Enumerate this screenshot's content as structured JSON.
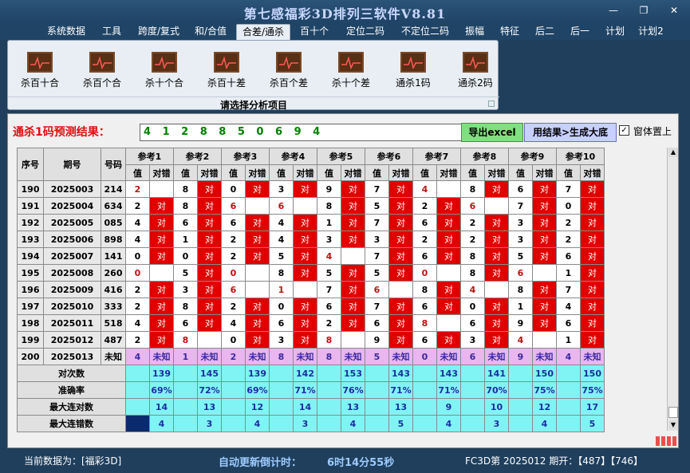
{
  "window": {
    "title": "第七感福彩3D排列三软件V8.81"
  },
  "menu": [
    "系统数据",
    "工具",
    "跨度/复式",
    "和/合值",
    "合差/通杀",
    "百十个",
    "定位二码",
    "不定位二码",
    "振幅",
    "特征",
    "后二",
    "后一",
    "计划",
    "计划2"
  ],
  "menu_active": 4,
  "ribbon": {
    "buttons": [
      "杀百十合",
      "杀百个合",
      "杀十个合",
      "杀百十差",
      "杀百个差",
      "杀十个差",
      "通杀1码",
      "通杀2码"
    ],
    "caption": "请选择分析项目"
  },
  "prediction": {
    "label": "通杀1码预测结果：",
    "value": "4 1 2 8 8 5 0 6 9 4",
    "export_label": "导出excel",
    "apply_label": "用结果>生成大底",
    "ontop_label": "窗体置上",
    "ontop_checked": "✓"
  },
  "table": {
    "col_seq": "序号",
    "col_period": "期号",
    "col_num": "号码",
    "refs": [
      "参考1",
      "参考2",
      "参考3",
      "参考4",
      "参考5",
      "参考6",
      "参考7",
      "参考8",
      "参考9",
      "参考10"
    ],
    "sub_value": "值",
    "sub_check": "对错",
    "right_mark": "对",
    "rows": [
      {
        "id": "190",
        "period": "2025003",
        "num": "214",
        "v": [
          "2",
          "8",
          "0",
          "3",
          "9",
          "7",
          "4",
          "8",
          "6",
          "7"
        ],
        "ok": [
          0,
          1,
          1,
          1,
          1,
          1,
          0,
          1,
          1,
          1
        ]
      },
      {
        "id": "191",
        "period": "2025004",
        "num": "634",
        "v": [
          "2",
          "8",
          "6",
          "6",
          "8",
          "5",
          "2",
          "6",
          "7",
          "0"
        ],
        "ok": [
          1,
          1,
          0,
          0,
          1,
          1,
          1,
          0,
          1,
          1
        ]
      },
      {
        "id": "192",
        "period": "2025005",
        "num": "085",
        "v": [
          "4",
          "6",
          "6",
          "4",
          "1",
          "7",
          "6",
          "2",
          "3",
          "2"
        ],
        "ok": [
          1,
          1,
          1,
          1,
          1,
          1,
          1,
          1,
          1,
          1
        ]
      },
      {
        "id": "193",
        "period": "2025006",
        "num": "898",
        "v": [
          "4",
          "1",
          "2",
          "4",
          "3",
          "3",
          "2",
          "2",
          "3",
          "2"
        ],
        "ok": [
          1,
          1,
          1,
          1,
          1,
          1,
          1,
          1,
          1,
          1
        ]
      },
      {
        "id": "194",
        "period": "2025007",
        "num": "141",
        "v": [
          "0",
          "0",
          "2",
          "5",
          "4",
          "7",
          "6",
          "8",
          "5",
          "6"
        ],
        "ok": [
          1,
          1,
          1,
          1,
          0,
          1,
          1,
          1,
          1,
          1
        ]
      },
      {
        "id": "195",
        "period": "2025008",
        "num": "260",
        "v": [
          "0",
          "5",
          "0",
          "8",
          "5",
          "5",
          "0",
          "8",
          "6",
          "1"
        ],
        "ok": [
          0,
          1,
          0,
          1,
          1,
          1,
          0,
          1,
          0,
          1
        ]
      },
      {
        "id": "196",
        "period": "2025009",
        "num": "416",
        "v": [
          "2",
          "3",
          "6",
          "1",
          "7",
          "6",
          "8",
          "4",
          "8",
          "7"
        ],
        "ok": [
          1,
          1,
          0,
          0,
          1,
          0,
          1,
          0,
          1,
          1
        ]
      },
      {
        "id": "197",
        "period": "2025010",
        "num": "333",
        "v": [
          "2",
          "8",
          "2",
          "0",
          "6",
          "7",
          "6",
          "0",
          "1",
          "4"
        ],
        "ok": [
          1,
          1,
          1,
          1,
          1,
          1,
          1,
          1,
          1,
          1
        ]
      },
      {
        "id": "198",
        "period": "2025011",
        "num": "518",
        "v": [
          "4",
          "6",
          "4",
          "6",
          "2",
          "6",
          "8",
          "6",
          "9",
          "6"
        ],
        "ok": [
          1,
          1,
          1,
          1,
          1,
          1,
          0,
          1,
          1,
          1
        ]
      },
      {
        "id": "199",
        "period": "2025012",
        "num": "487",
        "v": [
          "2",
          "8",
          "0",
          "3",
          "8",
          "9",
          "6",
          "3",
          "4",
          "1"
        ],
        "ok": [
          1,
          0,
          1,
          1,
          0,
          1,
          1,
          1,
          0,
          1
        ]
      }
    ],
    "pending": {
      "id": "200",
      "period": "2025013",
      "num": "未知",
      "v": [
        "4",
        "1",
        "2",
        "8",
        "8",
        "5",
        "0",
        "6",
        "9",
        "4"
      ],
      "unknown": "未知"
    },
    "stats": [
      {
        "label": "对次数",
        "vals": [
          "139",
          "145",
          "139",
          "142",
          "153",
          "143",
          "143",
          "141",
          "150",
          "150"
        ]
      },
      {
        "label": "准确率",
        "vals": [
          "69%",
          "72%",
          "69%",
          "71%",
          "76%",
          "71%",
          "71%",
          "70%",
          "75%",
          "75%"
        ]
      },
      {
        "label": "最大连对数",
        "vals": [
          "14",
          "13",
          "12",
          "14",
          "13",
          "13",
          "9",
          "10",
          "12",
          "17"
        ]
      },
      {
        "label": "最大连错数",
        "vals": [
          "4",
          "3",
          "4",
          "3",
          "4",
          "5",
          "4",
          "3",
          "4",
          "5"
        ]
      }
    ]
  },
  "status": {
    "current_data": "当前数据为：[福彩3D]",
    "countdown_label": "自动更新倒计时：",
    "countdown_value": "6时14分55秒",
    "issue": "FC3D第 2025012 期开：【487】【746】"
  },
  "colors": {
    "red": "#e00000",
    "unknown": "#e9b6f0",
    "stat": "#80f4f4",
    "titlebar": "#1f4466"
  }
}
